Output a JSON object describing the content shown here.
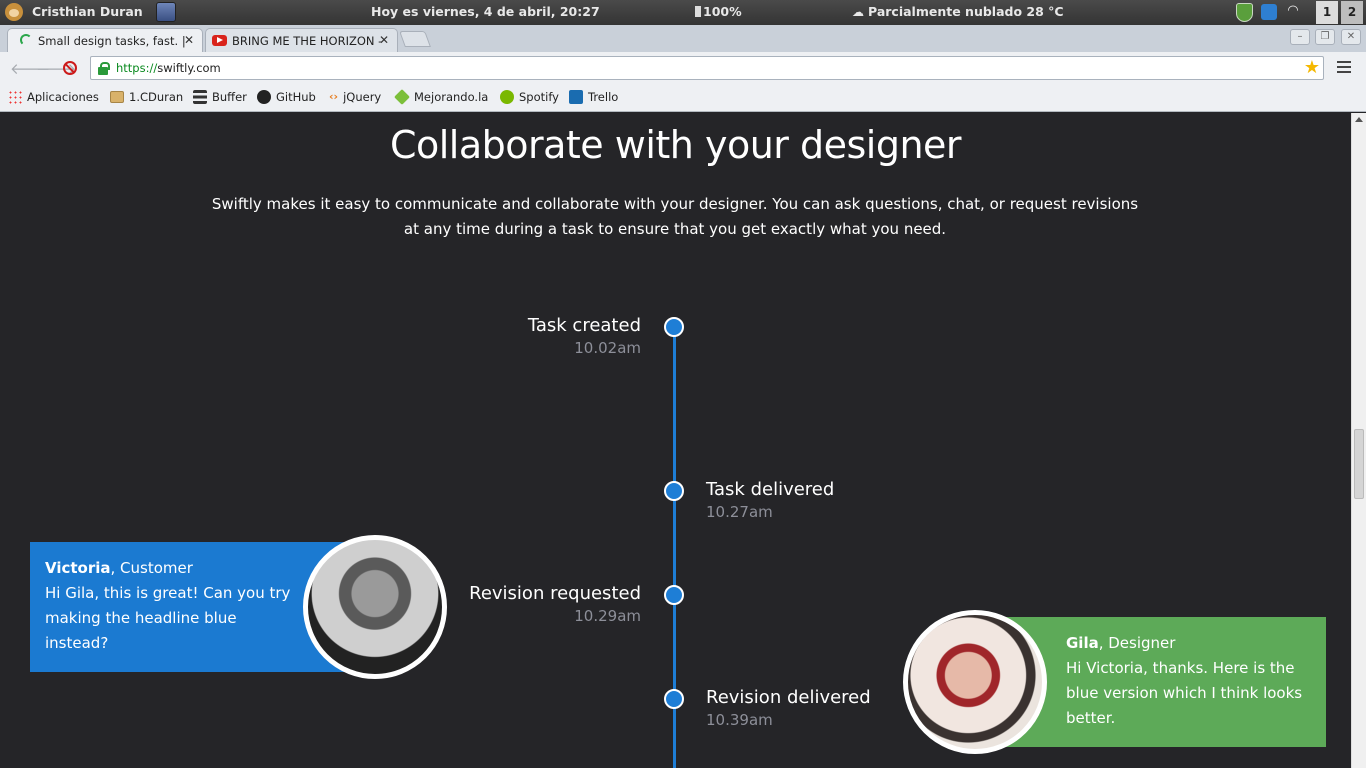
{
  "os_panel": {
    "user": "Cristhian Duran",
    "datetime": "Hoy es viernes, 4 de abril, 20:27",
    "battery": "100%",
    "weather": "Parcialmente nublado 28 °C",
    "workspaces": [
      "1",
      "2"
    ]
  },
  "browser": {
    "tabs": [
      {
        "label": "Small design tasks, fast. |"
      },
      {
        "label": "BRING ME THE HORIZON -"
      }
    ],
    "url_scheme": "https://",
    "url_host": "swiftly.com",
    "bookmarks": [
      {
        "label": "Aplicaciones",
        "icon": "apps-grid-icon"
      },
      {
        "label": "1.CDuran",
        "icon": "folder-icon"
      },
      {
        "label": "Buffer",
        "icon": "buffer-icon"
      },
      {
        "label": "GitHub",
        "icon": "github-icon"
      },
      {
        "label": "jQuery",
        "icon": "jquery-icon"
      },
      {
        "label": "Mejorando.la",
        "icon": "mejorando-icon"
      },
      {
        "label": "Spotify",
        "icon": "spotify-icon"
      },
      {
        "label": "Trello",
        "icon": "trello-icon"
      }
    ]
  },
  "page": {
    "title": "Collaborate with your designer",
    "intro": "Swiftly makes it easy to communicate and collaborate with your designer. You can ask questions, chat, or request revisions at any time during a task to ensure that you get exactly what you need.",
    "timeline": [
      {
        "title": "Task created",
        "time": "10.02am"
      },
      {
        "title": "Task delivered",
        "time": "10.27am"
      },
      {
        "title": "Revision requested",
        "time": "10.29am"
      },
      {
        "title": "Revision delivered",
        "time": "10.39am"
      }
    ],
    "messages": [
      {
        "name": "Victoria",
        "role": ", Customer",
        "text": "Hi Gila, this is great! Can you try making the headline blue instead?"
      },
      {
        "name": "Gila",
        "role": ", Designer",
        "text": "Hi Victoria, thanks. Here is the blue version which I think looks better."
      }
    ],
    "colors": {
      "accent_blue": "#1b7ad1",
      "accent_green": "#5daa58",
      "background": "#252528"
    }
  }
}
